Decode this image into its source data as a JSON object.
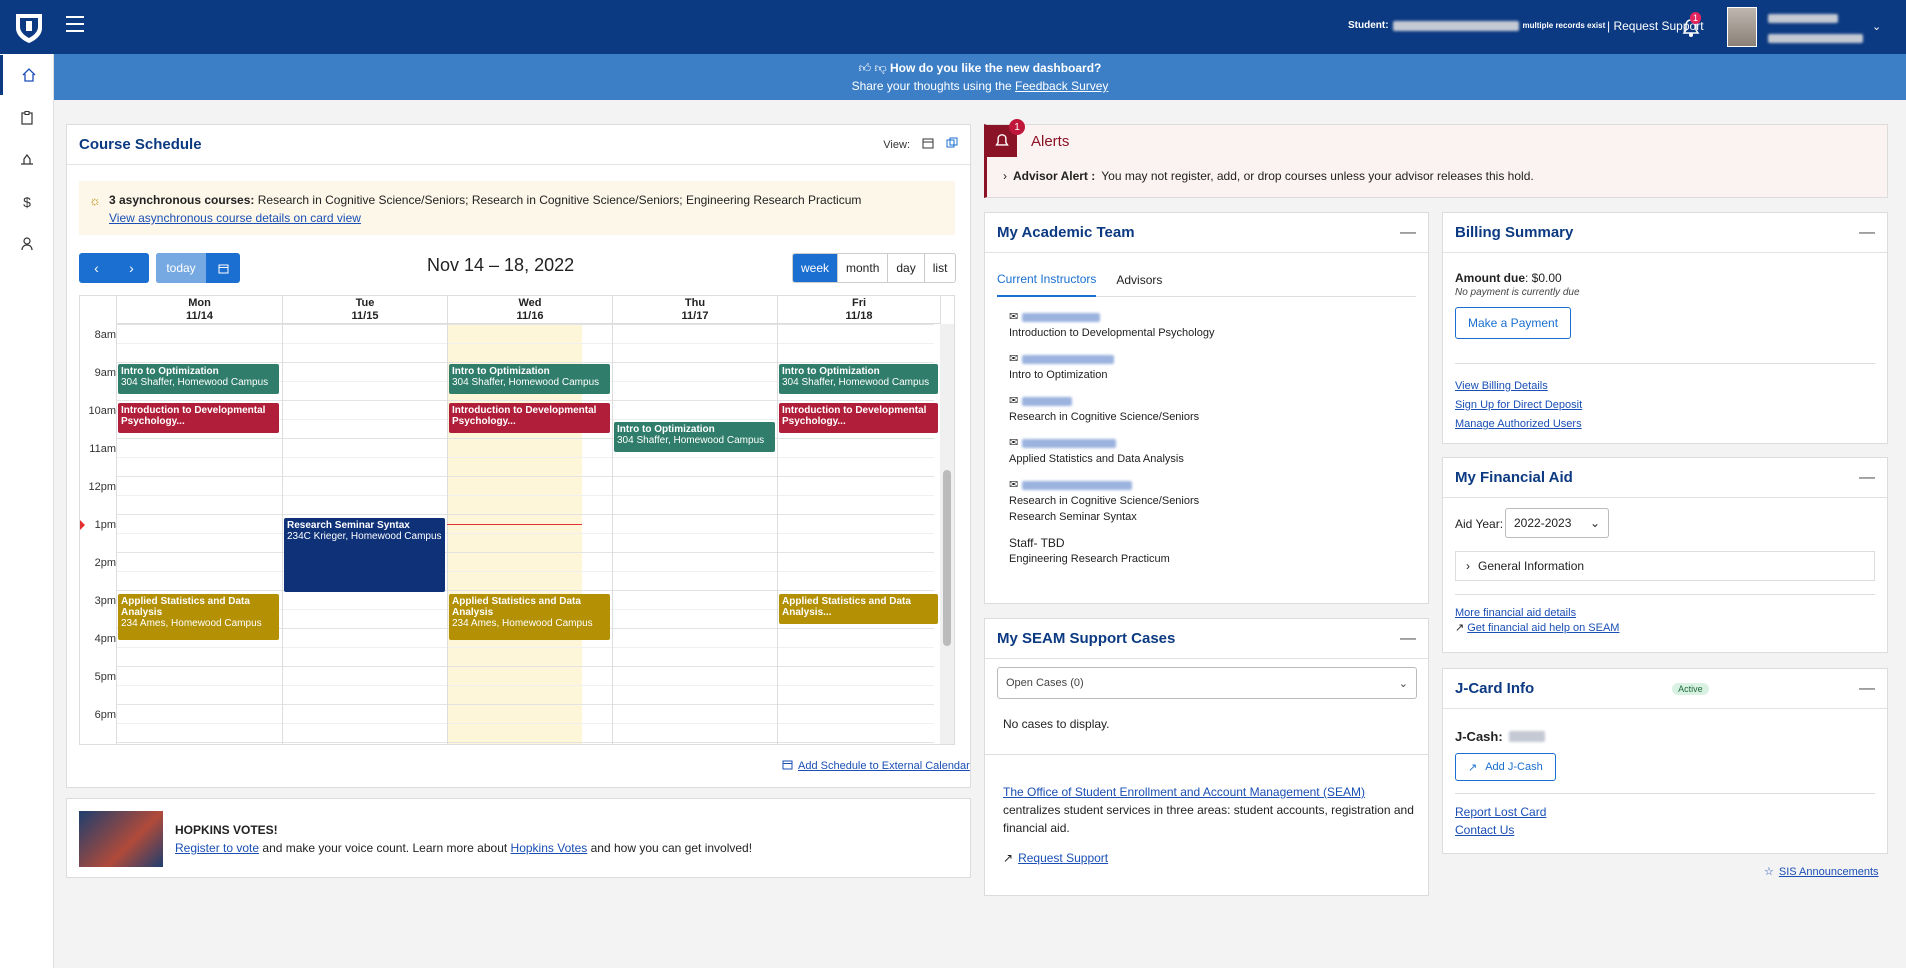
{
  "topbar": {
    "student_label": "Student:",
    "records_note": "multiple records exist",
    "separator": "|",
    "request_support": "Request Support",
    "notifications_count": "1"
  },
  "banner": {
    "question": "How do you like the new dashboard?",
    "share_text": "Share your thoughts using the",
    "survey_link": "Feedback Survey"
  },
  "schedule": {
    "title": "Course Schedule",
    "view_label": "View:",
    "async_count": "3 asynchronous courses:",
    "async_list": "Research in Cognitive Science/Seniors; Research in Cognitive Science/Seniors; Engineering Research Practicum",
    "async_link": "View asynchronous course details on card view",
    "today": "today",
    "range": "Nov 14 – 18, 2022",
    "views": [
      "week",
      "month",
      "day",
      "list"
    ],
    "days": [
      {
        "dow": "Mon",
        "date": "11/14"
      },
      {
        "dow": "Tue",
        "date": "11/15"
      },
      {
        "dow": "Wed",
        "date": "11/16"
      },
      {
        "dow": "Thu",
        "date": "11/17"
      },
      {
        "dow": "Fri",
        "date": "11/18"
      }
    ],
    "times": [
      "8am",
      "9am",
      "10am",
      "11am",
      "12pm",
      "1pm",
      "2pm",
      "3pm",
      "4pm",
      "5pm",
      "6pm"
    ],
    "events": {
      "opt": {
        "title": "Intro to Optimization",
        "loc": "304 Shaffer, Homewood Campus"
      },
      "dev": {
        "title": "Introduction to Developmental Psychology..."
      },
      "syn": {
        "title": "Research Seminar Syntax",
        "loc": "234C Krieger, Homewood Campus"
      },
      "stat": {
        "title": "Applied Statistics and Data Analysis",
        "loc": "234 Ames, Homewood Campus"
      },
      "stat_short": {
        "title": "Applied Statistics and Data Analysis..."
      }
    },
    "add_external": "Add Schedule to External Calendar"
  },
  "votes": {
    "title": "HOPKINS VOTES!",
    "register_link": "Register to vote",
    "text1": "and make your voice count. Learn more about",
    "hv_link": "Hopkins Votes",
    "text2": "and how you can get involved!"
  },
  "alerts": {
    "title": "Alerts",
    "count": "1",
    "advisor_label": "Advisor Alert :",
    "advisor_text": "You may not register, add, or drop courses unless your advisor releases this hold."
  },
  "team": {
    "title": "My Academic Team",
    "tab_instructors": "Current Instructors",
    "tab_advisors": "Advisors",
    "instructors": [
      {
        "course": "Introduction to Developmental Psychology"
      },
      {
        "course": "Intro to Optimization"
      },
      {
        "course": "Research in Cognitive Science/Seniors"
      },
      {
        "course": "Applied Statistics and Data Analysis"
      },
      {
        "course": "Research in Cognitive Science/Seniors",
        "course2": "Research Seminar Syntax"
      }
    ],
    "staff_name": "Staff- TBD",
    "staff_course": "Engineering Research Practicum"
  },
  "seam": {
    "title": "My SEAM Support Cases",
    "select": "Open Cases (0)",
    "empty": "No cases to display.",
    "office_link": "The Office of Student Enrollment and Account Management (SEAM)",
    "desc": "centralizes student services in three areas: student accounts, registration and financial aid.",
    "request": "Request Support"
  },
  "billing": {
    "title": "Billing Summary",
    "amount_label": "Amount due",
    "amount": ": $0.00",
    "note": "No payment is currently due",
    "pay_button": "Make a Payment",
    "links": [
      "View Billing Details",
      "Sign Up for Direct Deposit",
      "Manage Authorized Users"
    ]
  },
  "aid": {
    "title": "My Financial Aid",
    "year_label": "Aid Year:",
    "year": "2022-2023",
    "general": "General Information",
    "more_link": "More financial aid details",
    "help_link": "Get financial aid help on SEAM"
  },
  "jcard": {
    "title": "J-Card Info",
    "status": "Active",
    "cash_label": "J-Cash:",
    "add_button": "Add J-Cash",
    "lost": "Report Lost Card",
    "contact": "Contact Us"
  },
  "announcements": "SIS Announcements",
  "colors": {
    "navy": "#0c3a82",
    "banner": "#3c7fc7",
    "optimization": "#2f7d6a",
    "developmental": "#b11e3a",
    "syntax": "#0e3178",
    "statistics": "#b39004",
    "alert": "#8b1326"
  }
}
